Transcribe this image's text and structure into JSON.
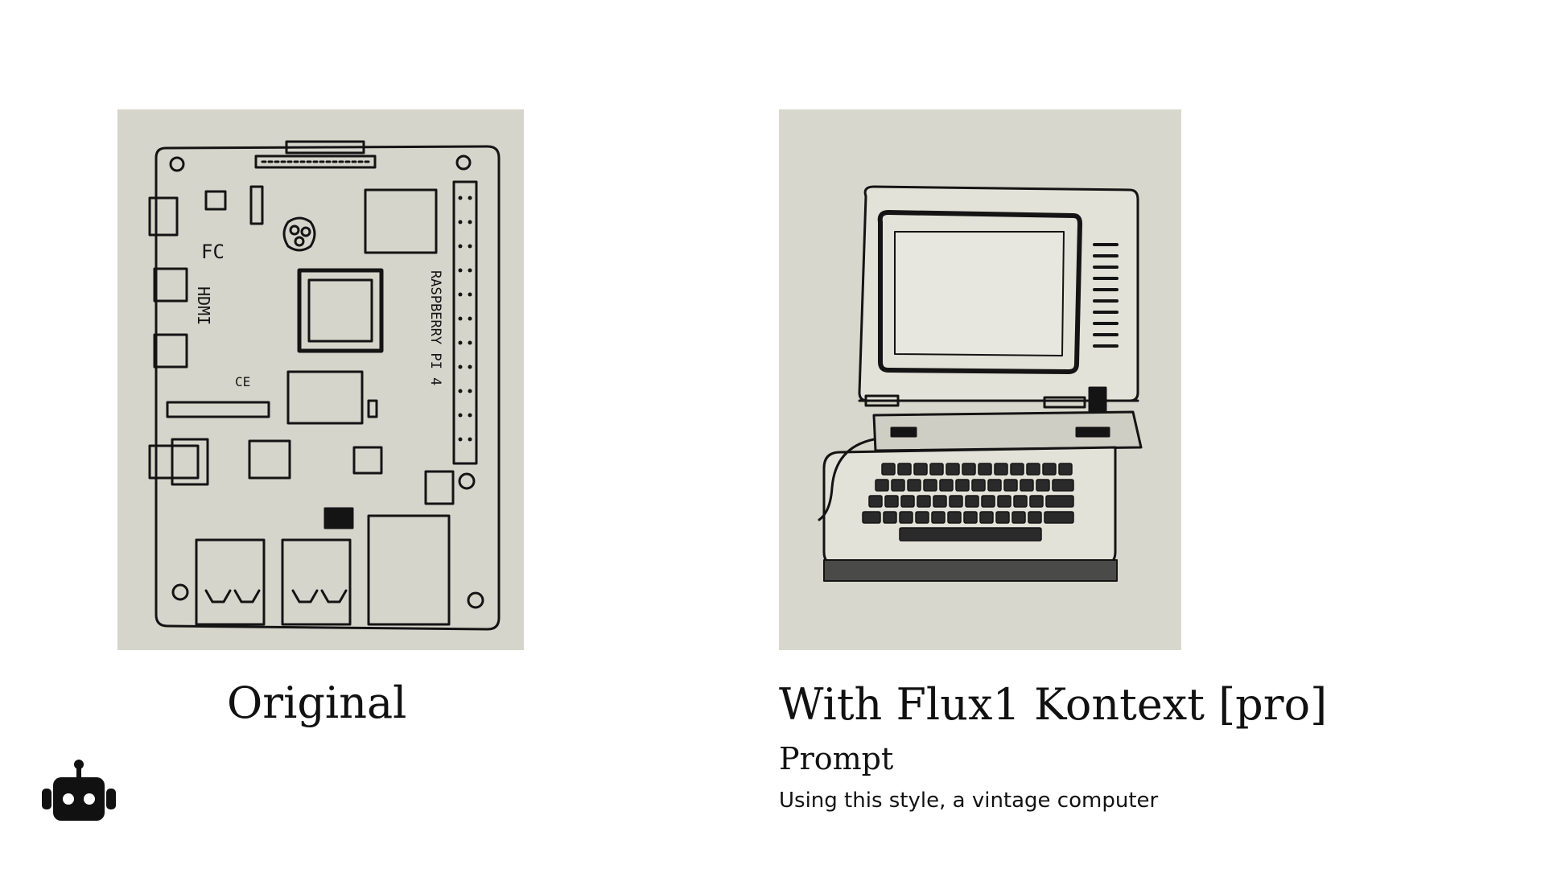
{
  "original": {
    "caption": "Original",
    "image_description_icon": "raspberry-pi-sketch",
    "board_label": "RASPBERRY PI 4",
    "board_marks": [
      "FC",
      "HDMI",
      "CE"
    ]
  },
  "edited": {
    "caption": "With Flux1 Kontext [pro]",
    "image_description_icon": "vintage-computer-sketch"
  },
  "prompt": {
    "heading": "Prompt",
    "text": "Using this style, a vintage computer"
  },
  "logo": {
    "icon": "robot-icon"
  },
  "colors": {
    "background": "#ffffff",
    "paper": "#d6d5cc",
    "ink": "#111111"
  }
}
